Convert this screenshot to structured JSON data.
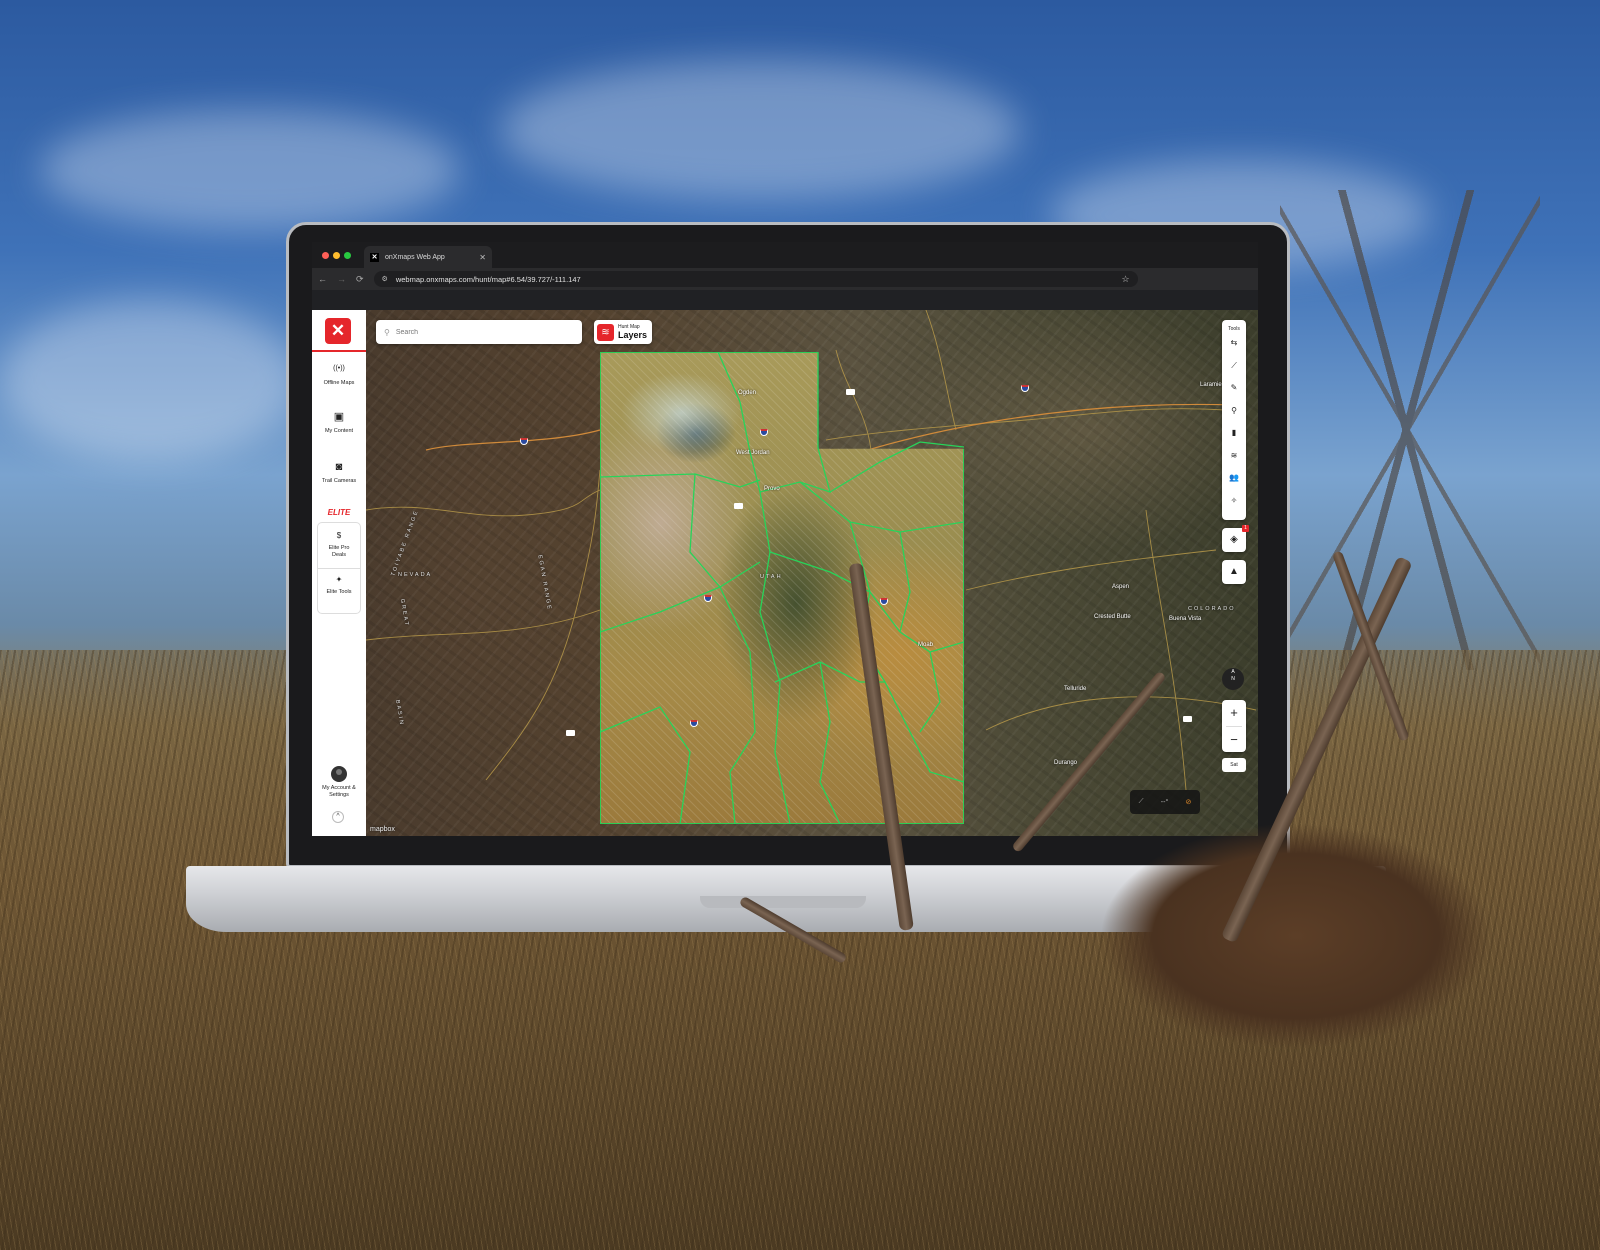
{
  "browser": {
    "tab_title": "onXmaps Web App",
    "tab_favicon": "✕",
    "tab_close": "✕",
    "url": "webmap.onxmaps.com/hunt/map#6.54/39.727/-111.147",
    "back": "←",
    "forward": "→",
    "reload": "⟳",
    "site_info": "⚙",
    "bookmark": "☆"
  },
  "sidebar": {
    "logo": "✕",
    "items": [
      {
        "label": "Offline Maps",
        "icon": "((•))",
        "icon_name": "offline-signal-icon"
      },
      {
        "label": "My Content",
        "icon": "▣",
        "icon_name": "folder-icon"
      },
      {
        "label": "Trail Cameras",
        "icon": "◙",
        "icon_name": "trail-camera-icon"
      }
    ],
    "elite_heading": "ELITE",
    "elite_items": [
      {
        "label": "Elite Pro Deals",
        "icon": "$"
      },
      {
        "label": "Elite Tools",
        "icon": "✦"
      }
    ],
    "account_label": "My Account & Settings",
    "collapse": "^"
  },
  "map": {
    "search_placeholder": "Search",
    "layers_small": "Hunt Map",
    "layers_big": "Layers",
    "tools_title": "Tools",
    "tools": [
      {
        "name": "route-icon",
        "glyph": "⇆"
      },
      {
        "name": "track-icon",
        "glyph": "⟋"
      },
      {
        "name": "draw-icon",
        "glyph": "✎"
      },
      {
        "name": "waypoint-icon",
        "glyph": "⚲"
      },
      {
        "name": "camera-icon",
        "glyph": "▮"
      },
      {
        "name": "wind-icon",
        "glyph": "≋"
      },
      {
        "name": "group-icon",
        "glyph": "👥"
      },
      {
        "name": "satellite-icon",
        "glyph": "✧"
      }
    ],
    "view_3d_badge": "1",
    "view_3d_glyph": "◈",
    "terrain_glyph": "▲",
    "compass": {
      "a": "A",
      "n": "N"
    },
    "zoom_in": "+",
    "zoom_out": "−",
    "basemap_label": "Sat",
    "measure_value": "--°",
    "attribution": "mapbox",
    "labels": {
      "ogden": "Ogden",
      "west_jordan": "West Jordan",
      "provo": "Provo",
      "utah": "UTAH",
      "nevada": "NEVADA",
      "colorado": "COLORADO",
      "aspen": "Aspen",
      "crested_butte": "Crested Butte",
      "buena_vista": "Buena Vista",
      "telluride": "Telluride",
      "durango": "Durango",
      "moab": "Moab",
      "laramie": "Laramie",
      "toiyabe": "TOIYABE RANGE",
      "egan": "EGAN RANGE",
      "basin": "BASIN",
      "great": "GREAT"
    },
    "shields": {
      "i80": "80",
      "i15": "15",
      "i70": "70",
      "us6": "6",
      "us89": "89",
      "us285": "285"
    }
  }
}
